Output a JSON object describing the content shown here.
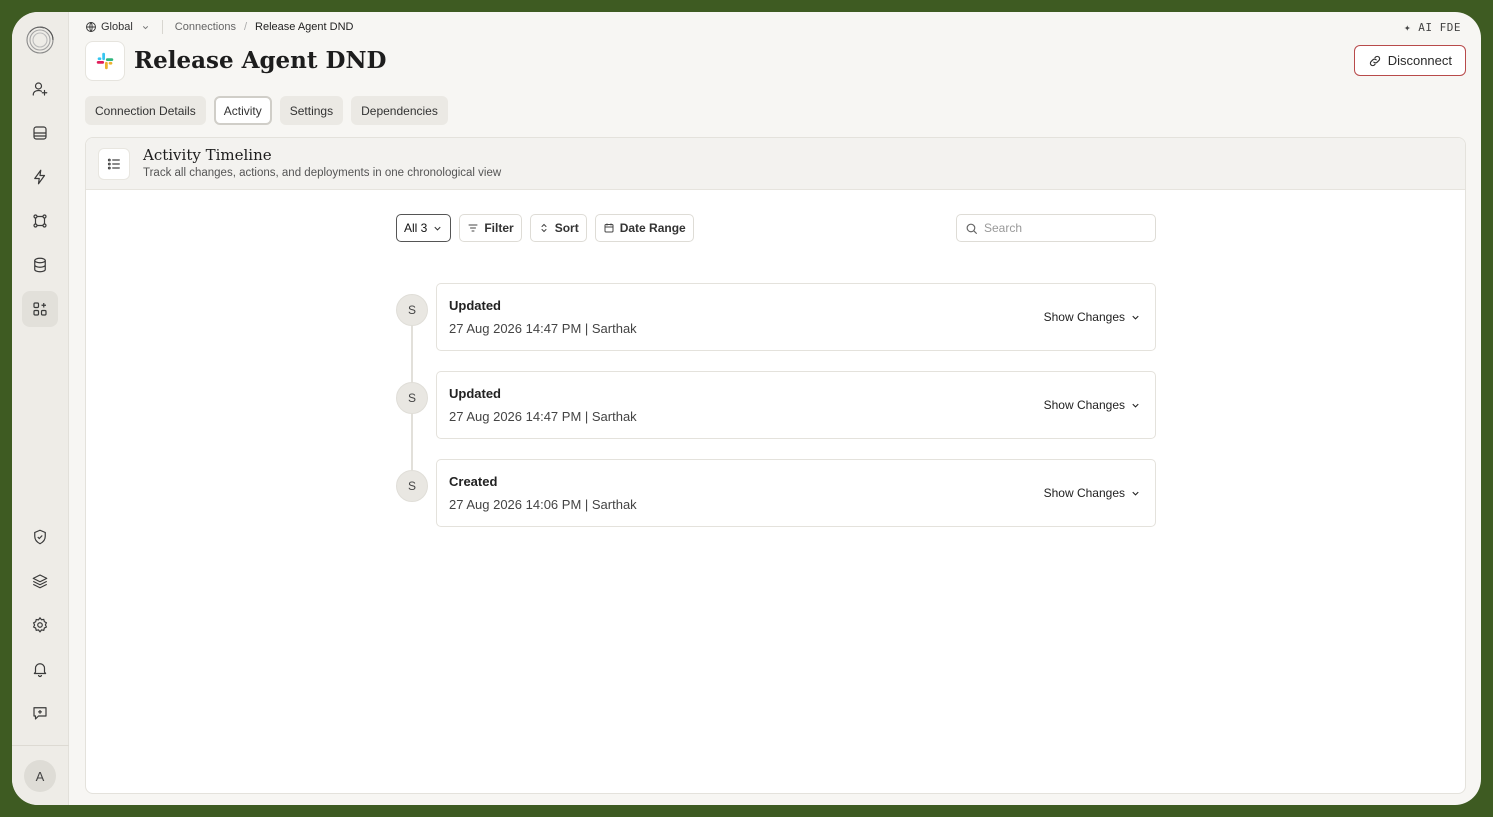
{
  "breadcrumb": {
    "scope": "Global",
    "items": [
      "Connections",
      "Release Agent DND"
    ]
  },
  "top_right": {
    "label": "✦ AI FDE"
  },
  "header": {
    "title": "Release Agent DND",
    "disconnect_label": "Disconnect"
  },
  "tabs": [
    {
      "label": "Connection Details",
      "active": false
    },
    {
      "label": "Activity",
      "active": true
    },
    {
      "label": "Settings",
      "active": false
    },
    {
      "label": "Dependencies",
      "active": false
    }
  ],
  "panel": {
    "title": "Activity Timeline",
    "subtitle": "Track all changes, actions, and deployments in one chronological view"
  },
  "toolbar": {
    "all_label": "All 3",
    "filter_label": "Filter",
    "sort_label": "Sort",
    "date_range_label": "Date Range",
    "search_placeholder": "Search"
  },
  "timeline": [
    {
      "avatar": "S",
      "action": "Updated",
      "meta": "27 Aug 2026 14:47 PM | Sarthak",
      "show_label": "Show Changes"
    },
    {
      "avatar": "S",
      "action": "Updated",
      "meta": "27 Aug 2026 14:47 PM | Sarthak",
      "show_label": "Show Changes"
    },
    {
      "avatar": "S",
      "action": "Created",
      "meta": "27 Aug 2026 14:06 PM | Sarthak",
      "show_label": "Show Changes"
    }
  ],
  "sidebar": {
    "avatar_initial": "A",
    "items_top": [
      "user-plus-icon",
      "inbox-icon",
      "bolt-icon",
      "workflow-icon",
      "database-icon",
      "apps-icon"
    ],
    "items_bottom": [
      "shield-icon",
      "layers-icon",
      "gear-icon",
      "bell-icon",
      "feedback-icon"
    ]
  },
  "colors": {
    "frame_bg": "#3e5b22",
    "danger_border": "#b84a4a"
  }
}
